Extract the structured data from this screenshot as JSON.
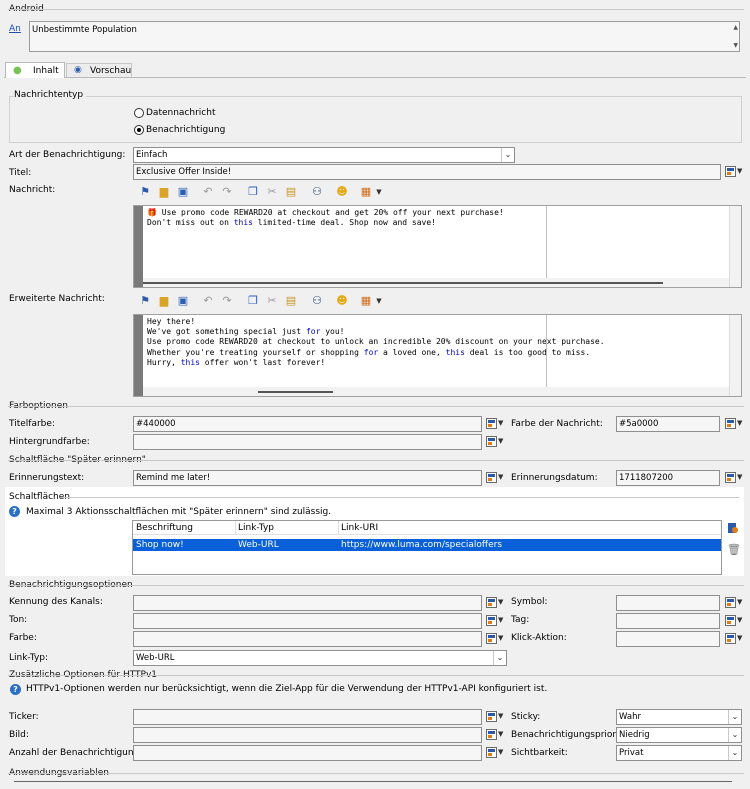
{
  "android": {
    "heading": "Android",
    "link": "An",
    "population": "Unbestimmte Population"
  },
  "tabs": [
    {
      "label": "Inhalt"
    },
    {
      "label": "Vorschau"
    }
  ],
  "message_type": {
    "heading": "Nachrichtentyp",
    "options": [
      "Datennachricht",
      "Benachrichtigung"
    ],
    "selected": "Benachrichtigung"
  },
  "form": {
    "notif_type_label": "Art der Benachrichtigung:",
    "notif_type_value": "Einfach",
    "title_label": "Titel:",
    "title_value": "Exclusive Offer Inside!",
    "message_label": "Nachricht:",
    "message_lines": [
      [
        {
          "t": "🎁 Use promo code REWARD20 at checkout and get 20% off your next purchase!"
        }
      ],
      [
        {
          "t": "Don't miss out on "
        },
        {
          "t": "this",
          "k": true
        },
        {
          "t": " limited-time deal. Shop now and save!"
        }
      ]
    ],
    "extended_label": "Erweiterte Nachricht:",
    "extended_lines": [
      [
        {
          "t": "Hey there!"
        }
      ],
      [
        {
          "t": "We've got something special just "
        },
        {
          "t": "for",
          "k": true
        },
        {
          "t": " you!"
        }
      ],
      [
        {
          "t": "Use promo code REWARD20 at checkout to unlock an incredible 20% discount on your next purchase."
        }
      ],
      [
        {
          "t": "Whether you're treating yourself or shopping "
        },
        {
          "t": "for",
          "k": true
        },
        {
          "t": " a loved one, "
        },
        {
          "t": "this",
          "k": true
        },
        {
          "t": " deal is too good to miss."
        }
      ],
      [
        {
          "t": "Hurry, "
        },
        {
          "t": "this",
          "k": true
        },
        {
          "t": " offer won't last forever!"
        }
      ]
    ]
  },
  "color_options": {
    "heading": "Farboptionen",
    "title_color_label": "Titelfarbe:",
    "title_color_value": "#440000",
    "msg_color_label": "Farbe der Nachricht:",
    "msg_color_value": "#5a0000",
    "bg_color_label": "Hintergrundfarbe:",
    "bg_color_value": ""
  },
  "remind": {
    "heading": "Schaltfläche \"Später erinnern\"",
    "text_label": "Erinnerungstext:",
    "text_value": "Remind me later!",
    "date_label": "Erinnerungsdatum:",
    "date_value": "1711807200"
  },
  "buttons": {
    "heading": "Schaltflächen",
    "info": "Maximal 3 Aktionsschaltflächen mit \"Später erinnern\" sind zulässig.",
    "columns": [
      "Beschriftung",
      "Link-Typ",
      "Link-URI"
    ],
    "rows": [
      [
        "Shop now!",
        "Web-URL",
        "https://www.luma.com/specialoffers"
      ]
    ]
  },
  "notif_options": {
    "heading": "Benachrichtigungsoptionen",
    "channel_label": "Kennung des Kanals:",
    "channel_value": "",
    "symbol_label": "Symbol:",
    "symbol_value": "",
    "tone_label": "Ton:",
    "tone_value": "",
    "tag_label": "Tag:",
    "tag_value": "",
    "color_label": "Farbe:",
    "color_value": "",
    "click_label": "Klick-Aktion:",
    "click_value": "",
    "linktype_label": "Link-Typ:",
    "linktype_value": "Web-URL"
  },
  "httpv1": {
    "heading": "Zusätzliche Optionen für HTTPv1",
    "info": "HTTPv1-Optionen werden nur berücksichtigt, wenn die Ziel-App für die Verwendung der HTTPv1-API konfiguriert ist.",
    "ticker_label": "Ticker:",
    "ticker_value": "",
    "image_label": "Bild:",
    "image_value": "",
    "count_label": "Anzahl der Benachrichtigungen:",
    "count_value": "",
    "sticky_label": "Sticky:",
    "sticky_value": "Wahr",
    "priority_label": "Benachrichtigungspriorität:",
    "priority_value": "Niedrig",
    "visibility_label": "Sichtbarkeit:",
    "visibility_value": "Privat"
  },
  "app_vars": {
    "heading": "Anwendungsvariablen"
  },
  "colors": {
    "accent": "#0a60d8",
    "selected_row": "#0a60d8",
    "keyword": "#0000c8",
    "highlight_bg": "#ffffff"
  }
}
